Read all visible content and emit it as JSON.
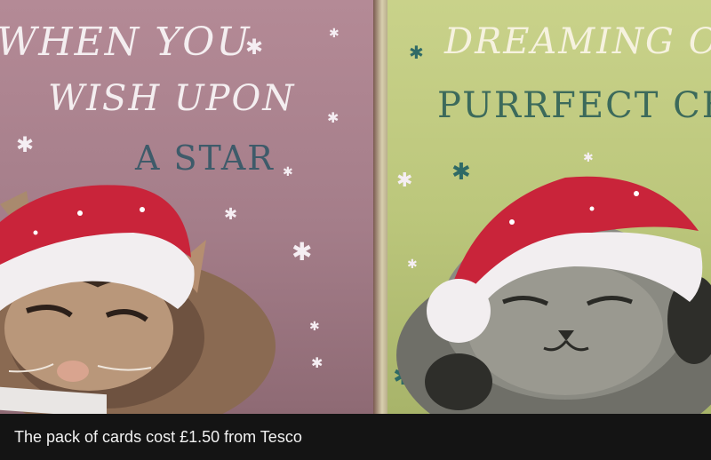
{
  "image": {
    "cards": [
      {
        "lines": [
          "WHEN YOU",
          "WISH UPON",
          "A STAR"
        ],
        "colors": {
          "background": "#b48a96",
          "text": "#f4eef0",
          "accent_text": "#3e5b6a",
          "hat": "#c9243a"
        }
      },
      {
        "lines": [
          "DREAMING OF",
          "PURRFECT CHRIS"
        ],
        "colors": {
          "background": "#c9d28a",
          "text": "#f6f2df",
          "accent_text": "#3c6a5b",
          "hat": "#c9243a"
        }
      }
    ]
  },
  "caption": {
    "text": "The pack of cards cost £1.50 from Tesco"
  }
}
